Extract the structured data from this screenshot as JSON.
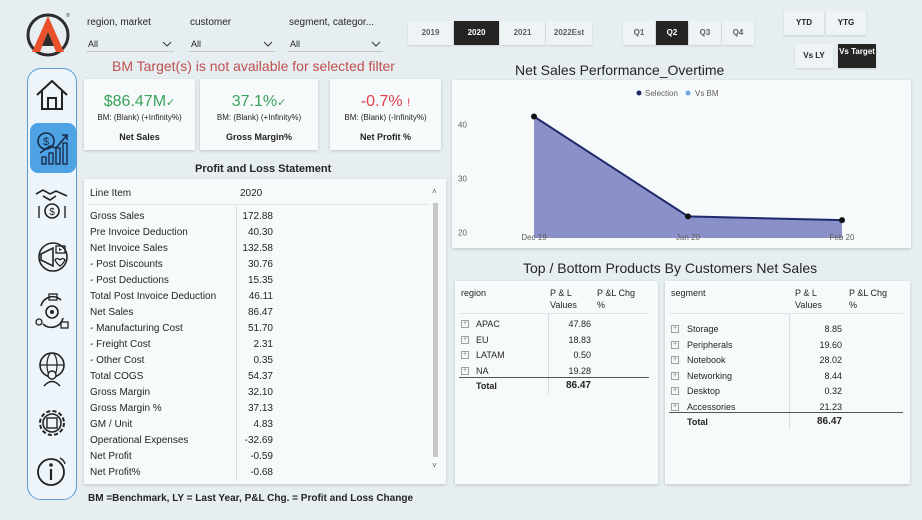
{
  "filters": {
    "region": {
      "label": "region, market",
      "value": "All"
    },
    "customer": {
      "label": "customer",
      "value": "All"
    },
    "segment": {
      "label": "segment, categor...",
      "value": "All"
    }
  },
  "years": [
    "2019",
    "2020",
    "2021",
    "2022Est"
  ],
  "selected_year": "2020",
  "quarters": [
    "Q1",
    "Q2",
    "Q3",
    "Q4"
  ],
  "selected_quarter": "Q2",
  "period_buttons": {
    "ytd": "YTD",
    "ytg": "YTG",
    "vs_ly": "Vs LY",
    "vs_target": "Vs Target"
  },
  "bm_warning": "BM Target(s) is not available for selected filter",
  "kpis": [
    {
      "value": "$86.47M",
      "mark": "✓",
      "sub": "BM: (Blank) (+Infinity%)",
      "title": "Net Sales",
      "color": "#3aa35a"
    },
    {
      "value": "37.1%",
      "mark": "✓",
      "sub": "BM: (Blank) (+Infinity%)",
      "title": "Gross Margin%",
      "color": "#3aa35a"
    },
    {
      "value": "-0.7%",
      "mark": "!",
      "sub": "BM: (Blank) (-Infinity%)",
      "title": "Net Profit %",
      "color": "#e0404a"
    }
  ],
  "pl": {
    "title": "Profit and Loss Statement",
    "header_item": "Line Item",
    "header_year": "2020",
    "rows": [
      {
        "item": "Gross Sales",
        "value": "172.88"
      },
      {
        "item": "Pre Invoice Deduction",
        "value": "40.30"
      },
      {
        "item": "Net Invoice Sales",
        "value": "132.58"
      },
      {
        "item": " - Post Discounts",
        "value": "30.76"
      },
      {
        "item": " - Post Deductions",
        "value": "15.35"
      },
      {
        "item": "Total Post Invoice Deduction",
        "value": "46.11"
      },
      {
        "item": "Net Sales",
        "value": "86.47"
      },
      {
        "item": " - Manufacturing Cost",
        "value": "51.70"
      },
      {
        "item": " - Freight Cost",
        "value": "2.31"
      },
      {
        "item": " - Other Cost",
        "value": "0.35"
      },
      {
        "item": "Total COGS",
        "value": "54.37"
      },
      {
        "item": "Gross Margin",
        "value": "32.10"
      },
      {
        "item": "Gross Margin %",
        "value": "37.13"
      },
      {
        "item": "GM / Unit",
        "value": "4.83"
      },
      {
        "item": "Operational Expenses",
        "value": "-32.69"
      },
      {
        "item": "Net Profit",
        "value": "-0.59"
      },
      {
        "item": "Net Profit%",
        "value": "-0.68"
      }
    ]
  },
  "perf_chart": {
    "title": "Net Sales Performance_Overtime",
    "legend": [
      {
        "name": "Selection",
        "color": "#1f2a6b"
      },
      {
        "name": "Vs BM",
        "color": "#6fa8dc"
      }
    ]
  },
  "chart_data": {
    "type": "area",
    "x": [
      "Dec 19",
      "Jan 20",
      "Feb 20"
    ],
    "series": [
      {
        "name": "Selection",
        "values": [
          41.5,
          23.0,
          22.3
        ]
      }
    ],
    "yticks": [
      20,
      30,
      40
    ],
    "ylim": [
      19,
      44
    ],
    "colors": {
      "line": "#1f2a6b",
      "fill": "#8a90c8"
    }
  },
  "top_bottom_title": "Top / Bottom Products By Customers Net Sales",
  "region_table": {
    "headers": [
      "region",
      "P & L Values",
      "P &L Chg %"
    ],
    "rows": [
      {
        "name": "APAC",
        "value": "47.86"
      },
      {
        "name": "EU",
        "value": "18.83"
      },
      {
        "name": "LATAM",
        "value": "0.50"
      },
      {
        "name": "NA",
        "value": "19.28"
      }
    ],
    "total_label": "Total",
    "total_value": "86.47"
  },
  "segment_table": {
    "headers": [
      "segment",
      "P & L Values",
      "P &L Chg %"
    ],
    "rows": [
      {
        "name": "Storage",
        "value": "8.85"
      },
      {
        "name": "Peripherals",
        "value": "19.60"
      },
      {
        "name": "Notebook",
        "value": "28.02"
      },
      {
        "name": "Networking",
        "value": "8.44"
      },
      {
        "name": "Desktop",
        "value": "0.32"
      },
      {
        "name": "Accessories",
        "value": "21.23"
      }
    ],
    "total_label": "Total",
    "total_value": "86.47"
  },
  "footer_note": "BM =Benchmark, LY = Last Year, P&L Chg. = Profit and Loss Change"
}
